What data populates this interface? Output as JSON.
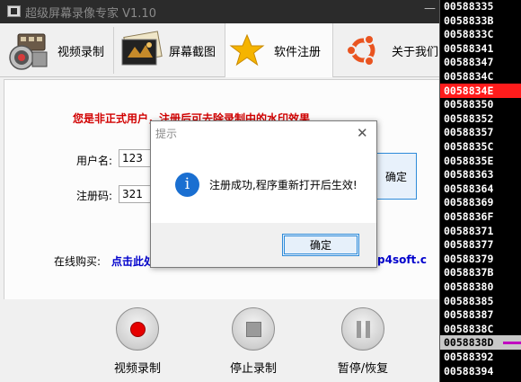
{
  "window": {
    "title": "超级屏幕录像专家 V1.10",
    "minimize_glyph": "—"
  },
  "toolbar": {
    "tabs": [
      {
        "label": "视频录制",
        "icon": "camera-film-icon"
      },
      {
        "label": "屏幕截图",
        "icon": "photo-icon"
      },
      {
        "label": "软件注册",
        "icon": "star-icon"
      },
      {
        "label": "关于我们",
        "icon": "ubuntu-logo-icon"
      }
    ],
    "active_tab": "软件注册"
  },
  "register": {
    "warning": "您是非正式用户，注册后可去除录制中的水印效果",
    "username_label": "用户名:",
    "username_value": "123",
    "code_label": "注册码:",
    "code_value": "321",
    "confirm_label": "确定",
    "buy_label": "在线购买:",
    "buy_link_text": "点击此处",
    "buy_link_tail": "p4soft.c"
  },
  "controls": [
    {
      "label": "视频录制",
      "icon": "record-icon"
    },
    {
      "label": "停止录制",
      "icon": "stop-icon"
    },
    {
      "label": "暂停/恢复",
      "icon": "pause-icon"
    }
  ],
  "dialog": {
    "title": "提示",
    "message": "注册成功,程序重新打开后生效!",
    "ok_label": "确定",
    "icon": "info-icon",
    "close_glyph": "✕"
  },
  "hex_list": {
    "rows": [
      "00588335",
      "0058833B",
      "0058833C",
      "00588341",
      "00588347",
      "0058834C",
      "0058834E",
      "00588350",
      "00588352",
      "00588357",
      "0058835C",
      "0058835E",
      "00588363",
      "00588364",
      "00588369",
      "0058836F",
      "00588371",
      "00588377",
      "00588379",
      "0058837B",
      "00588380",
      "00588385",
      "00588387",
      "0058838C",
      "0058838D",
      "00588392",
      "00588394"
    ],
    "highlight_red": "0058834E",
    "highlight_selected": "0058838D"
  },
  "colors": {
    "warning": "#d10000",
    "link": "#0000cc",
    "hex_highlight": "#ff1c1c",
    "accent_blue": "#2e8bd9",
    "record_red": "#e60000"
  }
}
